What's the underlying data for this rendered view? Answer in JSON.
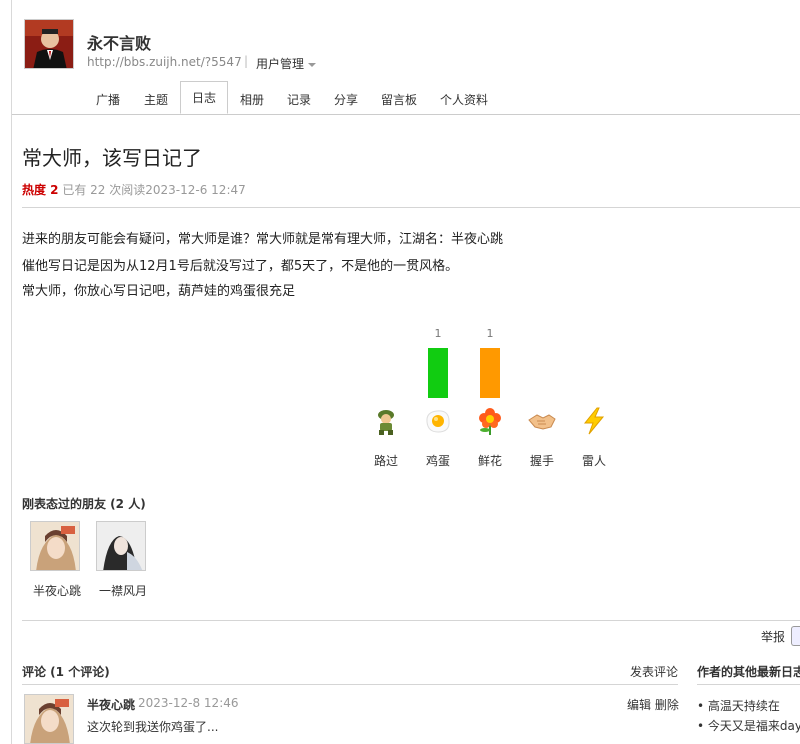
{
  "header": {
    "username": "永不言败",
    "url": "http://bbs.zuijh.net/?5547",
    "separator": "|",
    "user_mgmt": "用户管理"
  },
  "tabs": [
    {
      "label": "广播"
    },
    {
      "label": "主题"
    },
    {
      "label": "日志",
      "active": true
    },
    {
      "label": "相册"
    },
    {
      "label": "记录"
    },
    {
      "label": "分享"
    },
    {
      "label": "留言板"
    },
    {
      "label": "个人资料"
    }
  ],
  "post": {
    "title": "常大师，该写日记了",
    "heat_label": "热度 2",
    "meta": "已有 22 次阅读2023-12-6 12:47",
    "paragraphs": [
      "进来的朋友可能会有疑问，常大师是谁？常大师就是常有理大师，江湖名：半夜心跳",
      "催他写日记是因为从12月1号后就没写过了，都5天了，不是他的一贯风格。",
      "常大师，你放心写日记吧，葫芦娃的鸡蛋很充足"
    ]
  },
  "reactions": [
    {
      "label": "路过",
      "count": 0,
      "icon": "soldier-icon",
      "color": "#22cc22"
    },
    {
      "label": "鸡蛋",
      "count": 1,
      "icon": "fried-egg-icon",
      "color": "#11cc11"
    },
    {
      "label": "鲜花",
      "count": 1,
      "icon": "flower-icon",
      "color": "#ff9900"
    },
    {
      "label": "握手",
      "count": 0,
      "icon": "handshake-icon",
      "color": "#22cc22"
    },
    {
      "label": "雷人",
      "count": 0,
      "icon": "lightning-icon",
      "color": "#22cc22"
    }
  ],
  "friends": {
    "title": "刚表态过的朋友 (2 人)",
    "list": [
      {
        "name": "半夜心跳"
      },
      {
        "name": "一襟风月"
      }
    ]
  },
  "report_label": "举报",
  "comments": {
    "title": "评论 (1 个评论)",
    "post_label": "发表评论",
    "items": [
      {
        "author": "半夜心跳",
        "time": "2023-12-8 12:46",
        "actions": "编辑 删除",
        "text": "这次轮到我送你鸡蛋了..."
      }
    ]
  },
  "other_posts": {
    "title": "作者的其他最新日志",
    "items": [
      "• 高温天持续在",
      "• 今天又是福来day"
    ]
  }
}
